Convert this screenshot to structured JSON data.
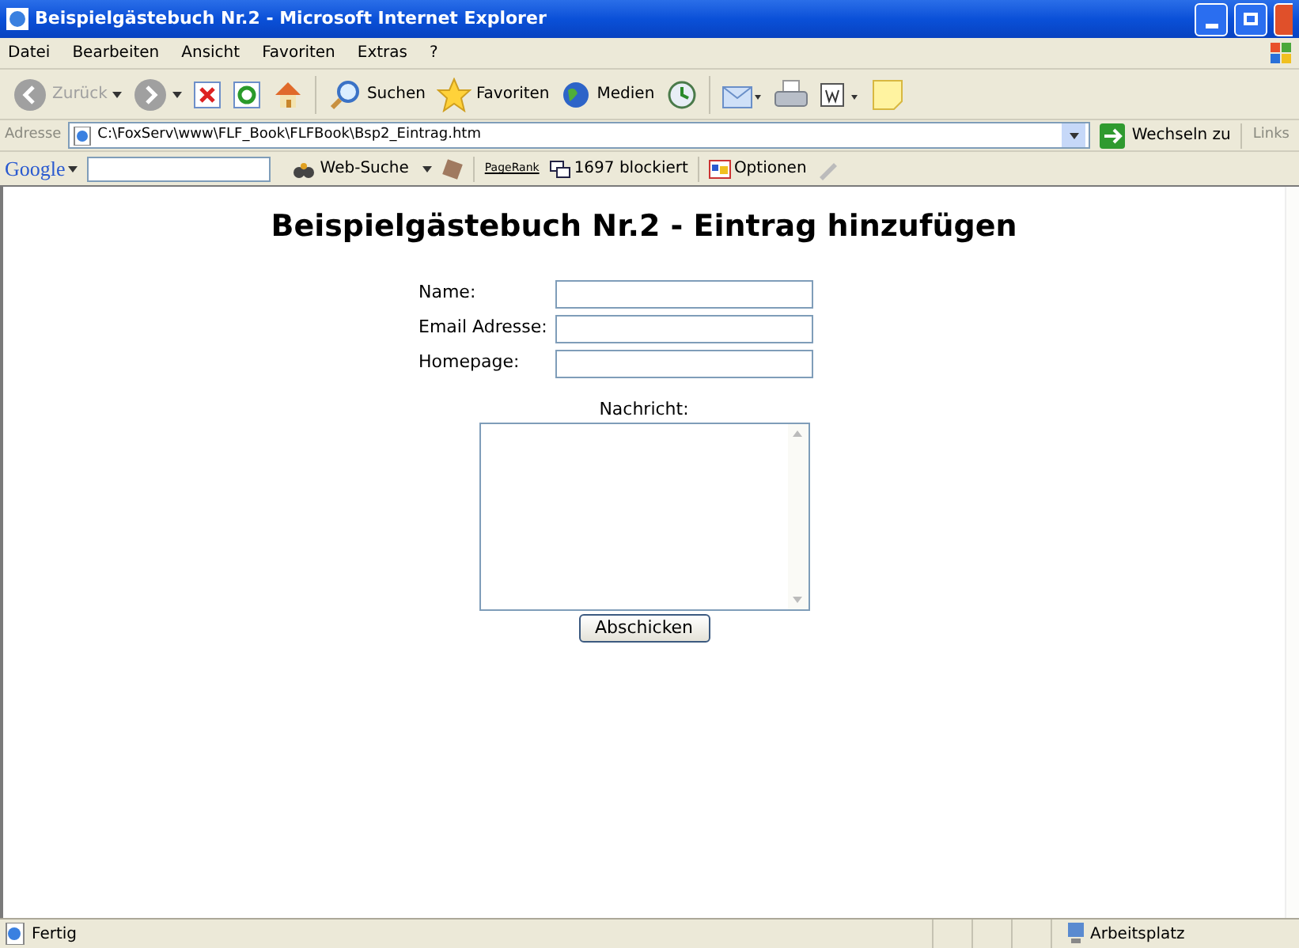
{
  "window": {
    "title": "Beispielgästebuch Nr.2 - Microsoft Internet Explorer"
  },
  "menu": [
    "Datei",
    "Bearbeiten",
    "Ansicht",
    "Favoriten",
    "Extras",
    "?"
  ],
  "toolbar": [
    {
      "kind": "back",
      "label": "Zurück",
      "disabled": true
    },
    {
      "kind": "forward",
      "disabled": true
    },
    {
      "kind": "stop"
    },
    {
      "kind": "refresh"
    },
    {
      "kind": "home"
    },
    {
      "kind": "sep"
    },
    {
      "kind": "search",
      "label": "Suchen"
    },
    {
      "kind": "favorites",
      "label": "Favoriten"
    },
    {
      "kind": "media",
      "label": "Medien"
    },
    {
      "kind": "history"
    },
    {
      "kind": "sep"
    },
    {
      "kind": "mail"
    },
    {
      "kind": "print"
    },
    {
      "kind": "word"
    },
    {
      "kind": "note"
    }
  ],
  "address": {
    "label": "Adresse",
    "value": "C:\\FoxServ\\www\\FLF_Book\\FLFBook\\Bsp2_Eintrag.htm",
    "go": "Wechseln zu",
    "links": "Links"
  },
  "google_bar": {
    "logo": "Google",
    "search": "Web-Suche",
    "pagerank": "PageRank",
    "blocked": "1697 blockiert",
    "options": "Optionen"
  },
  "page": {
    "heading": "Beispielgästebuch Nr.2 - Eintrag hinzufügen",
    "fields": [
      {
        "label": "Name:"
      },
      {
        "label": "Email Adresse:"
      },
      {
        "label": "Homepage:"
      }
    ],
    "message_label": "Nachricht:",
    "submit": "Abschicken"
  },
  "status_bar": {
    "text": "Fertig",
    "zone": "Arbeitsplatz"
  }
}
